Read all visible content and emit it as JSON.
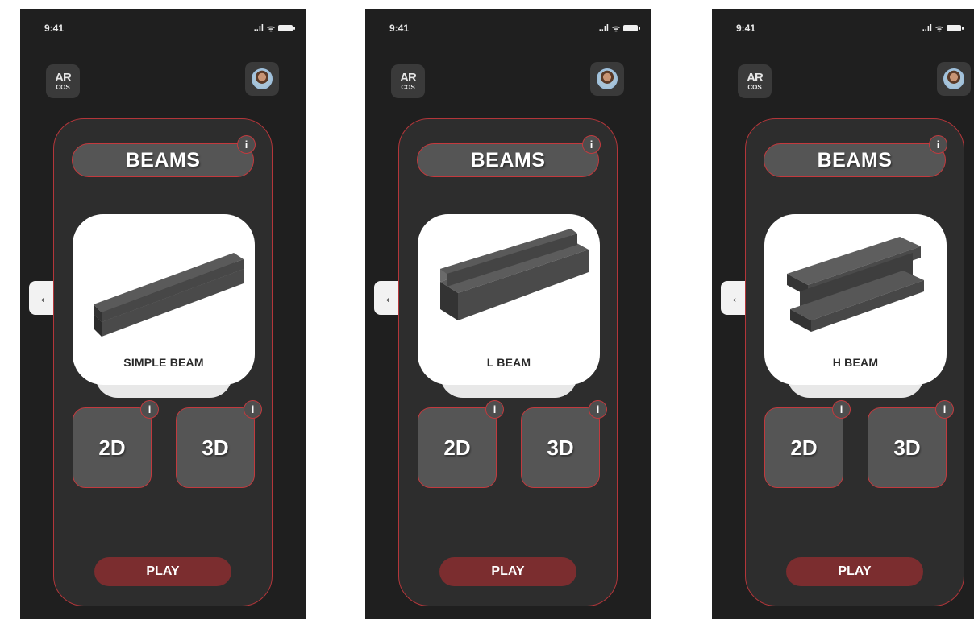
{
  "screens": [
    {
      "status": {
        "time": "9:41",
        "signal": "..ıl",
        "wifi": "ᯤ"
      },
      "logo": {
        "line1": "AR",
        "line2": "COS"
      },
      "title": "BEAMS",
      "info": "i",
      "back_arrow": "←",
      "beam": {
        "label": "SIMPLE BEAM",
        "icon": "simple-beam-icon"
      },
      "modes": [
        {
          "label": "2D"
        },
        {
          "label": "3D"
        }
      ],
      "play": "PLAY"
    },
    {
      "status": {
        "time": "9:41",
        "signal": "..ıl",
        "wifi": "ᯤ"
      },
      "logo": {
        "line1": "AR",
        "line2": "COS"
      },
      "title": "BEAMS",
      "info": "i",
      "back_arrow": "←",
      "beam": {
        "label": "L BEAM",
        "icon": "l-beam-icon"
      },
      "modes": [
        {
          "label": "2D"
        },
        {
          "label": "3D"
        }
      ],
      "play": "PLAY"
    },
    {
      "status": {
        "time": "9:41",
        "signal": "..ıl",
        "wifi": "ᯤ"
      },
      "logo": {
        "line1": "AR",
        "line2": "COS"
      },
      "title": "BEAMS",
      "info": "i",
      "back_arrow": "←",
      "beam": {
        "label": "H BEAM",
        "icon": "h-beam-icon"
      },
      "modes": [
        {
          "label": "2D"
        },
        {
          "label": "3D"
        }
      ],
      "play": "PLAY"
    }
  ],
  "colors": {
    "phone_bg": "#1f1f1f",
    "panel_bg": "#2d2d2d",
    "accent_red": "#b3363a",
    "play_button": "#7b2d2f",
    "button_gray": "#555555"
  }
}
